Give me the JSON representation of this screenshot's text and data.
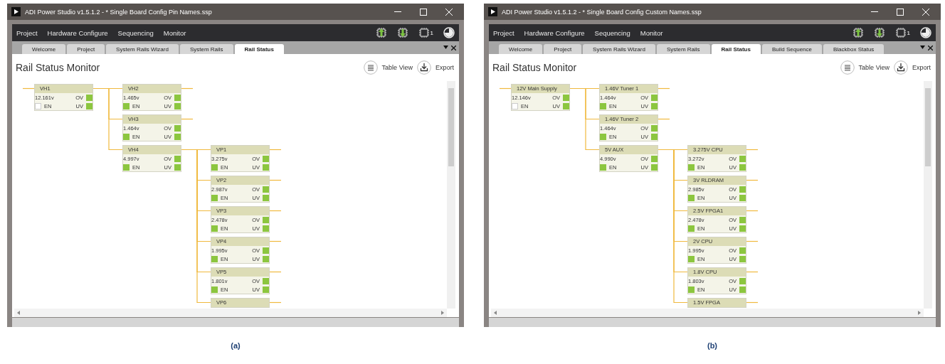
{
  "panels": [
    {
      "caption": "(a)",
      "window": {
        "title": "ADI Power Studio v1.5.1.2 - * Single Board Config Pin Names.ssp"
      },
      "menu": [
        "Project",
        "Hardware Configure",
        "Sequencing",
        "Monitor"
      ],
      "device_count": "1",
      "tabs": [
        {
          "label": "Welcome",
          "selected": false
        },
        {
          "label": "Project",
          "selected": false
        },
        {
          "label": "System Rails Wizard",
          "selected": false
        },
        {
          "label": "System Rails",
          "selected": false
        },
        {
          "label": "Rail Status",
          "selected": true
        }
      ],
      "page_title": "Rail Status Monitor",
      "actions": [
        "Table View",
        "Export"
      ],
      "rails": [
        {
          "name": "VH1",
          "reading": "12.161v",
          "ov": {
            "label": "OV",
            "on": true
          },
          "en": {
            "label": "EN",
            "on": false
          },
          "uv": {
            "label": "UV",
            "on": true
          },
          "children": [
            {
              "name": "VH2",
              "reading": "1.465v",
              "ov": {
                "label": "OV",
                "on": true
              },
              "en": {
                "label": "EN",
                "on": true
              },
              "uv": {
                "label": "UV",
                "on": true
              }
            },
            {
              "name": "VH3",
              "reading": "1.464v",
              "ov": {
                "label": "OV",
                "on": true
              },
              "en": {
                "label": "EN",
                "on": true
              },
              "uv": {
                "label": "UV",
                "on": true
              }
            },
            {
              "name": "VH4",
              "reading": "4.997v",
              "ov": {
                "label": "OV",
                "on": true
              },
              "en": {
                "label": "EN",
                "on": true
              },
              "uv": {
                "label": "UV",
                "on": true
              },
              "children": [
                {
                  "name": "VP1",
                  "reading": "3.275v",
                  "ov": {
                    "label": "OV",
                    "on": true
                  },
                  "en": {
                    "label": "EN",
                    "on": true
                  },
                  "uv": {
                    "label": "UV",
                    "on": true
                  }
                },
                {
                  "name": "VP2",
                  "reading": "2.987v",
                  "ov": {
                    "label": "OV",
                    "on": true
                  },
                  "en": {
                    "label": "EN",
                    "on": true
                  },
                  "uv": {
                    "label": "UV",
                    "on": true
                  }
                },
                {
                  "name": "VP3",
                  "reading": "2.478v",
                  "ov": {
                    "label": "OV",
                    "on": true
                  },
                  "en": {
                    "label": "EN",
                    "on": true
                  },
                  "uv": {
                    "label": "UV",
                    "on": true
                  }
                },
                {
                  "name": "VP4",
                  "reading": "1.995v",
                  "ov": {
                    "label": "OV",
                    "on": true
                  },
                  "en": {
                    "label": "EN",
                    "on": true
                  },
                  "uv": {
                    "label": "UV",
                    "on": true
                  }
                },
                {
                  "name": "VP5",
                  "reading": "1.801v",
                  "ov": {
                    "label": "OV",
                    "on": true
                  },
                  "en": {
                    "label": "EN",
                    "on": true
                  },
                  "uv": {
                    "label": "UV",
                    "on": true
                  }
                },
                {
                  "name": "VP6"
                }
              ]
            }
          ]
        }
      ]
    },
    {
      "caption": "(b)",
      "window": {
        "title": "ADI Power Studio v1.5.1.2 - * Single Board Config Custom Names.ssp"
      },
      "menu": [
        "Project",
        "Hardware Configure",
        "Sequencing",
        "Monitor"
      ],
      "device_count": "1",
      "tabs": [
        {
          "label": "Welcome",
          "selected": false
        },
        {
          "label": "Project",
          "selected": false
        },
        {
          "label": "System Rails Wizard",
          "selected": false
        },
        {
          "label": "System Rails",
          "selected": false
        },
        {
          "label": "Rail Status",
          "selected": true
        },
        {
          "label": "Build Sequence",
          "selected": false
        },
        {
          "label": "Blackbox Status",
          "selected": false
        }
      ],
      "page_title": "Rail Status Monitor",
      "actions": [
        "Table View",
        "Export"
      ],
      "rails": [
        {
          "name": "12V Main Supply",
          "reading": "12.146v",
          "ov": {
            "label": "OV",
            "on": true
          },
          "en": {
            "label": "EN",
            "on": false
          },
          "uv": {
            "label": "UV",
            "on": true
          },
          "children": [
            {
              "name": "1.46V Tuner 1",
              "reading": "1.464v",
              "ov": {
                "label": "OV",
                "on": true
              },
              "en": {
                "label": "EN",
                "on": true
              },
              "uv": {
                "label": "UV",
                "on": true
              }
            },
            {
              "name": "1.46V Tuner 2",
              "reading": "1.464v",
              "ov": {
                "label": "OV",
                "on": true
              },
              "en": {
                "label": "EN",
                "on": true
              },
              "uv": {
                "label": "UV",
                "on": true
              }
            },
            {
              "name": "5V AUX",
              "reading": "4.990v",
              "ov": {
                "label": "OV",
                "on": true
              },
              "en": {
                "label": "EN",
                "on": true
              },
              "uv": {
                "label": "UV",
                "on": true
              },
              "children": [
                {
                  "name": "3.275V CPU",
                  "reading": "3.272v",
                  "ov": {
                    "label": "OV",
                    "on": true
                  },
                  "en": {
                    "label": "EN",
                    "on": true
                  },
                  "uv": {
                    "label": "UV",
                    "on": true
                  }
                },
                {
                  "name": "3V RLDRAM",
                  "reading": "2.985v",
                  "ov": {
                    "label": "OV",
                    "on": true
                  },
                  "en": {
                    "label": "EN",
                    "on": true
                  },
                  "uv": {
                    "label": "UV",
                    "on": true
                  }
                },
                {
                  "name": "2.5V FPGA1",
                  "reading": "2.478v",
                  "ov": {
                    "label": "OV",
                    "on": true
                  },
                  "en": {
                    "label": "EN",
                    "on": true
                  },
                  "uv": {
                    "label": "UV",
                    "on": true
                  }
                },
                {
                  "name": "2V CPU",
                  "reading": "1.995v",
                  "ov": {
                    "label": "OV",
                    "on": true
                  },
                  "en": {
                    "label": "EN",
                    "on": true
                  },
                  "uv": {
                    "label": "UV",
                    "on": true
                  }
                },
                {
                  "name": "1.8V CPU",
                  "reading": "1.803v",
                  "ov": {
                    "label": "OV",
                    "on": true
                  },
                  "en": {
                    "label": "EN",
                    "on": true
                  },
                  "uv": {
                    "label": "UV",
                    "on": true
                  }
                },
                {
                  "name": "1.5V FPGA"
                }
              ]
            }
          ]
        }
      ]
    }
  ]
}
